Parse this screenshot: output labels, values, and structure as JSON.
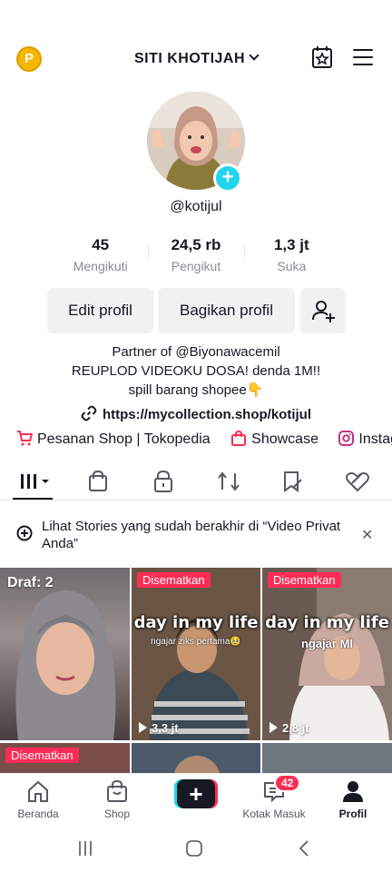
{
  "header": {
    "coin_label": "P",
    "username": "SITI KHOTIJAH",
    "icons": [
      "coin-icon",
      "calendar-star-icon",
      "hamburger-menu-icon"
    ]
  },
  "profile": {
    "handle": "@kotijul",
    "stats": [
      {
        "value": "45",
        "label": "Mengikuti"
      },
      {
        "value": "24,5 rb",
        "label": "Pengikut"
      },
      {
        "value": "1,3 jt",
        "label": "Suka"
      }
    ],
    "buttons": {
      "edit": "Edit profil",
      "share": "Bagikan profil"
    },
    "bio": [
      "Partner of @Biyonawacemil",
      "REUPLOD VIDEOKU DOSA! denda 1M!!",
      "spill barang shopee👇"
    ],
    "link": "https://mycollection.shop/kotijul"
  },
  "shop_row": [
    {
      "icon": "cart-icon",
      "label": "Pesanan Shop | Tokopedia"
    },
    {
      "icon": "store-bag-icon",
      "label": "Showcase"
    },
    {
      "icon": "instagram-icon",
      "label": "Instagram"
    }
  ],
  "tabs": [
    "videos-grid-tab",
    "shop-bag-tab",
    "private-lock-tab",
    "reposts-tab",
    "favorites-tab",
    "liked-tab"
  ],
  "stories_notice": "Lihat Stories yang sudah berakhir di “Video Privat Anda”",
  "grid": {
    "draft_label": "Draf: 2",
    "pinned_label": "Disematkan",
    "tiles": [
      {
        "overlay": "",
        "sub": "",
        "views": ""
      },
      {
        "overlay": "day in my life",
        "sub": "ngajar ziks pertama🥹",
        "views": "3,3 jt"
      },
      {
        "overlay": "day in my life",
        "sub": "ngajar MI",
        "views": "2,8 jt"
      }
    ]
  },
  "bottom_nav": {
    "home": "Beranda",
    "shop": "Shop",
    "create": "+",
    "inbox": "Kotak Masuk",
    "inbox_count": "42",
    "profile": "Profil"
  },
  "colors": {
    "accent": "#fe2c55",
    "cyan": "#20d5ec",
    "text": "#161823",
    "muted": "#8a8b91"
  }
}
